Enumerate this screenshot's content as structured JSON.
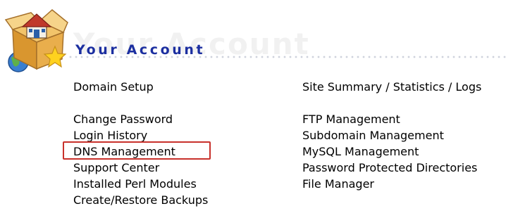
{
  "header": {
    "title": "Your Account",
    "ghost_title": "Your Account",
    "logo_icon": "house-box-globe-star-icon"
  },
  "left_menu": {
    "top": [
      "Domain Setup"
    ],
    "items": [
      "Change Password",
      "Login History",
      "DNS Management",
      "Support Center",
      "Installed Perl Modules",
      "Create/Restore Backups"
    ]
  },
  "right_menu": {
    "top": [
      "Site Summary / Statistics / Logs"
    ],
    "items": [
      "FTP Management",
      "Subdomain Management",
      "MySQL Management",
      "Password Protected Directories",
      "File Manager"
    ]
  },
  "highlighted_item": "DNS Management",
  "colors": {
    "title": "#1c2fa0",
    "highlight_border": "#c8312b",
    "ghost_text": "#f1f1f1"
  }
}
